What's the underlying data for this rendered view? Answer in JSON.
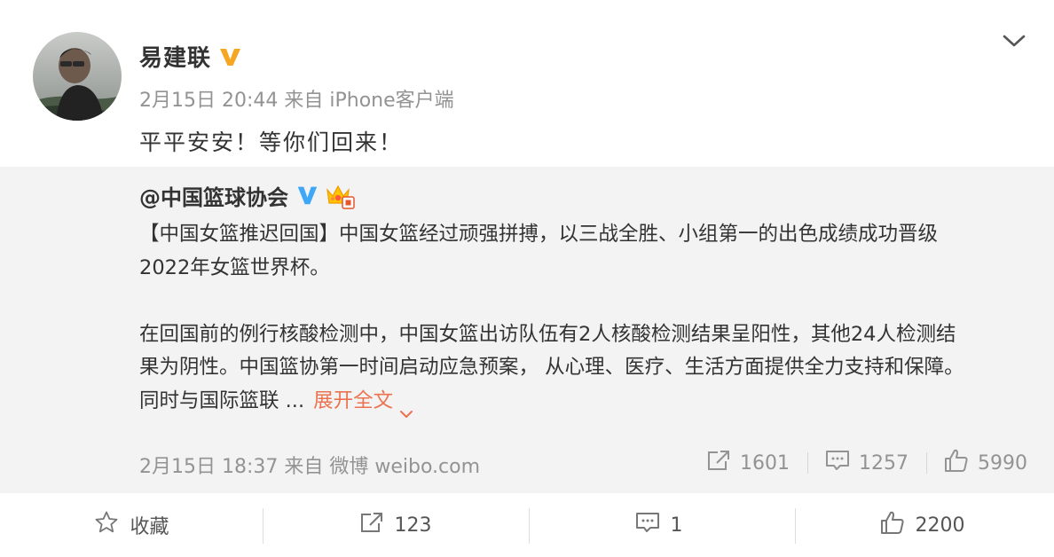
{
  "post": {
    "author": "易建联",
    "meta": "2月15日 20:44 来自 iPhone客户端",
    "text": "平平安安！等你们回来！"
  },
  "repost": {
    "author_prefix": "@",
    "author": "中国篮球协会",
    "lines": [
      "【中国女篮推迟回国】中国女篮经过顽强拼搏，以三战全胜、小组第一的出色成绩成功晋级",
      "2022年女篮世界杯。",
      "在回国前的例行核酸检测中，中国女篮出访队伍有2人核酸检测结果呈阳性，其他24人检测结",
      "果为阴性。中国篮协第一时间启动应急预案， 从心理、医疗、生活方面提供全力支持和保障。",
      "同时与国际篮联 ..."
    ],
    "expand_label": "展开全文",
    "meta": "2月15日 18:37 来自 微博 weibo.com",
    "stats": {
      "reposts": "1601",
      "comments": "1257",
      "likes": "5990"
    }
  },
  "actions": {
    "favorite": "收藏",
    "repost": "123",
    "comment": "1",
    "like": "2200"
  },
  "colors": {
    "accent_orange": "#eb7350",
    "verified_gold": "#f5a623",
    "verified_blue": "#3ea7f7",
    "meta_gray": "#939393",
    "repost_bg": "#f3f3f3"
  },
  "icons": [
    "more-chevron-icon",
    "verified-gold-icon",
    "verified-blue-icon",
    "crown-badge-icon",
    "repost-icon",
    "comment-icon",
    "like-icon",
    "star-icon"
  ]
}
